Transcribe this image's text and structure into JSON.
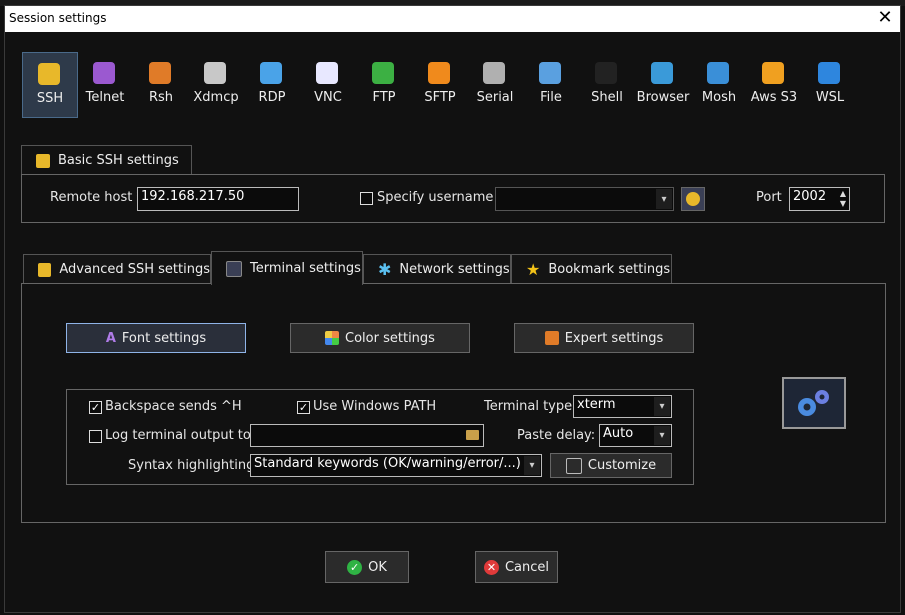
{
  "window": {
    "title": "Session settings",
    "close_glyph": "✕"
  },
  "toolbar": [
    {
      "label": "SSH",
      "icon": "ssh-key-icon",
      "color": "#e8b82a",
      "selected": true
    },
    {
      "label": "Telnet",
      "icon": "telnet-icon",
      "color": "#9b59d0"
    },
    {
      "label": "Rsh",
      "icon": "rsh-icon",
      "color": "#e07b28"
    },
    {
      "label": "Xdmcp",
      "icon": "xdmcp-icon",
      "color": "#c8c8c8"
    },
    {
      "label": "RDP",
      "icon": "rdp-icon",
      "color": "#4aa3e8"
    },
    {
      "label": "VNC",
      "icon": "vnc-icon",
      "color": "#e8e8ff"
    },
    {
      "label": "FTP",
      "icon": "ftp-icon",
      "color": "#3cb043"
    },
    {
      "label": "SFTP",
      "icon": "sftp-icon",
      "color": "#f08a1c"
    },
    {
      "label": "Serial",
      "icon": "serial-icon",
      "color": "#b0b0b0"
    },
    {
      "label": "File",
      "icon": "file-icon",
      "color": "#5aa0e0"
    },
    {
      "label": "Shell",
      "icon": "shell-icon",
      "color": "#222222"
    },
    {
      "label": "Browser",
      "icon": "browser-icon",
      "color": "#3a9ad9"
    },
    {
      "label": "Mosh",
      "icon": "mosh-icon",
      "color": "#3a8fd8"
    },
    {
      "label": "Aws S3",
      "icon": "aws-s3-icon",
      "color": "#f0a020"
    },
    {
      "label": "WSL",
      "icon": "wsl-icon",
      "color": "#2e86de"
    }
  ],
  "basic": {
    "tab_label": "Basic SSH settings",
    "remote_host_label": "Remote host *",
    "remote_host_value": "192.168.217.50",
    "specify_username_label": "Specify username",
    "specify_username_checked": false,
    "username_value": "",
    "port_label": "Port",
    "port_value": "2002"
  },
  "tabs": [
    {
      "label": "Advanced SSH settings",
      "icon": "key-icon",
      "active": false
    },
    {
      "label": "Terminal settings",
      "icon": "terminal-icon",
      "active": true
    },
    {
      "label": "Network settings",
      "icon": "network-icon",
      "active": false
    },
    {
      "label": "Bookmark settings",
      "icon": "star-icon",
      "active": false
    }
  ],
  "terminal": {
    "font_button": "Font settings",
    "color_button": "Color settings",
    "expert_button": "Expert settings",
    "backspace_label": "Backspace sends ^H",
    "backspace_checked": true,
    "windows_path_label": "Use Windows PATH",
    "windows_path_checked": true,
    "terminal_type_label": "Terminal type:",
    "terminal_type_value": "xterm",
    "log_output_label": "Log terminal output to:",
    "log_output_checked": false,
    "log_output_value": "",
    "paste_delay_label": "Paste delay:",
    "paste_delay_value": "Auto",
    "syntax_label": "Syntax highlighting:",
    "syntax_value": "Standard keywords (OK/warning/error/...)",
    "customize_button": "Customize"
  },
  "footer": {
    "ok_label": "OK",
    "cancel_label": "Cancel"
  },
  "check_glyph": "✓",
  "arrow_glyph": "▾"
}
